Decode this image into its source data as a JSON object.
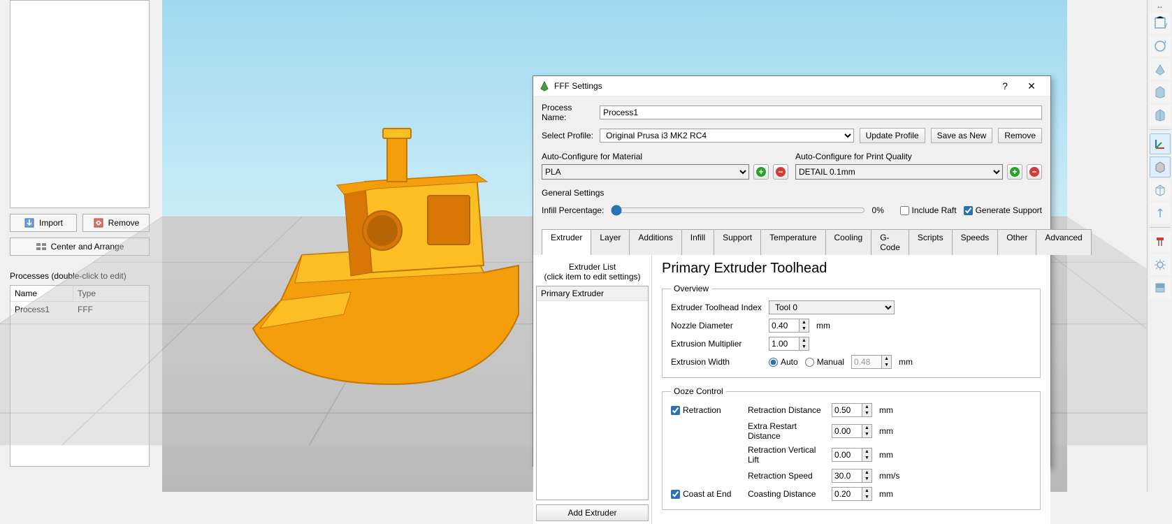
{
  "left": {
    "import_label": "Import",
    "remove_label": "Remove",
    "center_label": "Center and Arrange",
    "processes_label": "Processes (double-click to edit)",
    "col_name": "Name",
    "col_type": "Type",
    "row_name": "Process1",
    "row_type": "FFF"
  },
  "dialog": {
    "title": "FFF Settings",
    "process_name_label": "Process Name:",
    "process_name": "Process1",
    "select_profile_label": "Select Profile:",
    "profile": "Original Prusa i3 MK2 RC4",
    "update_profile": "Update Profile",
    "save_as_new": "Save as New",
    "remove": "Remove",
    "auto_material_label": "Auto-Configure for Material",
    "material": "PLA",
    "auto_quality_label": "Auto-Configure for Print Quality",
    "quality": "DETAIL 0.1mm",
    "general_settings": "General Settings",
    "infill_label": "Infill Percentage:",
    "infill_value": "0%",
    "include_raft": "Include Raft",
    "gen_support": "Generate Support",
    "tabs": [
      "Extruder",
      "Layer",
      "Additions",
      "Infill",
      "Support",
      "Temperature",
      "Cooling",
      "G-Code",
      "Scripts",
      "Speeds",
      "Other",
      "Advanced"
    ],
    "extruder_list_label": "Extruder List",
    "extruder_list_hint": "(click item to edit settings)",
    "extruder_item": "Primary Extruder",
    "add_extruder": "Add Extruder",
    "primary_heading": "Primary Extruder Toolhead",
    "overview_legend": "Overview",
    "toolhead_index_label": "Extruder Toolhead Index",
    "toolhead_index": "Tool 0",
    "nozzle_label": "Nozzle Diameter",
    "nozzle_val": "0.40",
    "mult_label": "Extrusion Multiplier",
    "mult_val": "1.00",
    "width_label": "Extrusion Width",
    "width_auto": "Auto",
    "width_manual": "Manual",
    "width_val": "0.48",
    "mm": "mm",
    "mms": "mm/s",
    "ooze_legend": "Ooze Control",
    "retraction": "Retraction",
    "retract_dist_label": "Retraction Distance",
    "retract_dist": "0.50",
    "extra_restart_label": "Extra Restart Distance",
    "extra_restart": "0.00",
    "vert_lift_label": "Retraction Vertical Lift",
    "vert_lift": "0.00",
    "retract_speed_label": "Retraction Speed",
    "retract_speed": "30.0",
    "coast_end": "Coast at End",
    "coast_dist_label": "Coasting Distance",
    "coast_dist": "0.20"
  }
}
